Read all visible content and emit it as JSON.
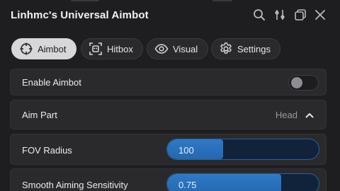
{
  "window": {
    "title": "Linhmc's Universal Aimbot"
  },
  "titlebar_icons": [
    "search-icon",
    "move-icon",
    "minimize-icon",
    "close-icon"
  ],
  "tabs": [
    {
      "label": "Aimbot",
      "icon": "crosshair-icon",
      "active": true
    },
    {
      "label": "Hitbox",
      "icon": "hitbox-icon",
      "active": false
    },
    {
      "label": "Visual",
      "icon": "eye-icon",
      "active": false
    },
    {
      "label": "Settings",
      "icon": "gear-icon",
      "active": false
    }
  ],
  "settings": {
    "enable_aimbot": {
      "label": "Enable Aimbot",
      "enabled": false
    },
    "aim_part": {
      "label": "Aim Part",
      "value": "Head",
      "expanded": true
    },
    "fov_radius": {
      "label": "FOV Radius",
      "value": "100",
      "fraction": 0.37
    },
    "smooth_aiming": {
      "label": "Smooth Aiming Sensitivity",
      "value": "0.75",
      "fraction": 0.75
    }
  },
  "colors": {
    "accent": "#2f79c6",
    "background": "#1e1e20",
    "row": "#2a2a2d",
    "active_tab": "#d7d7d9"
  }
}
